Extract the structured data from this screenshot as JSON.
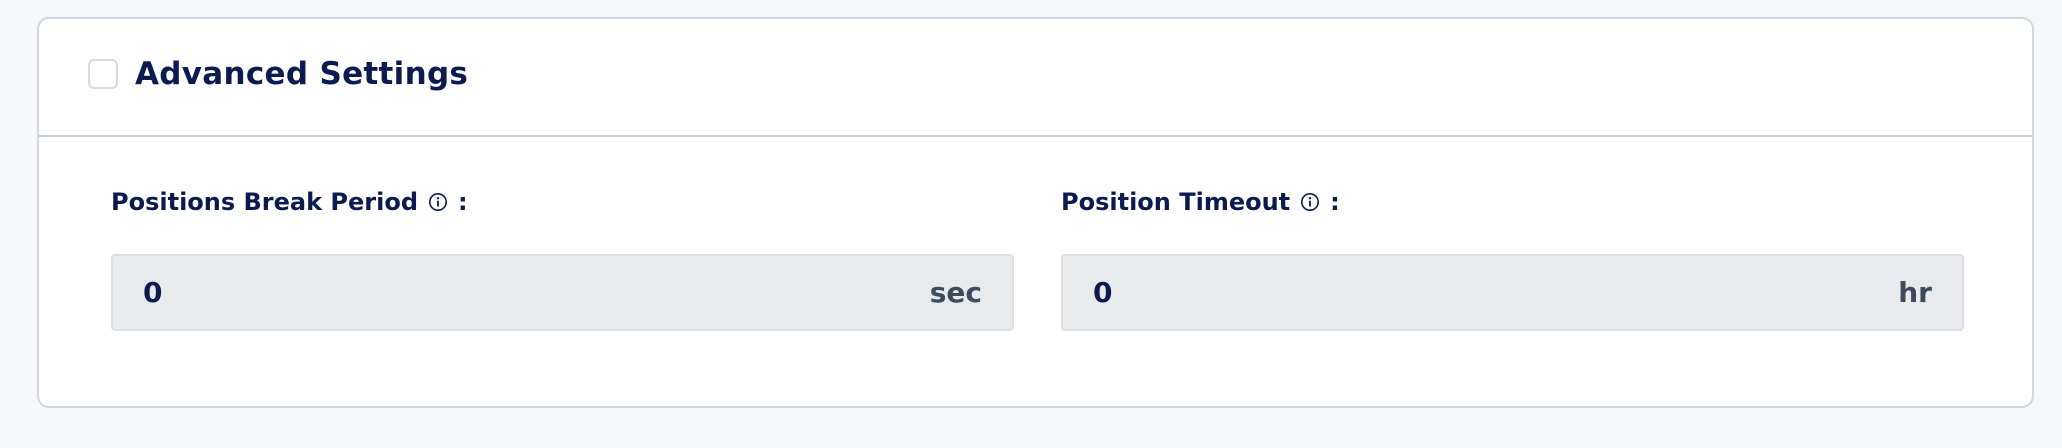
{
  "advanced_settings": {
    "title": "Advanced Settings",
    "checked": false
  },
  "fields": [
    {
      "label": "Positions Break Period",
      "colon": ":",
      "value": "0",
      "unit": "sec",
      "info_icon": "info-circle-icon"
    },
    {
      "label": "Position Timeout",
      "colon": ":",
      "value": "0",
      "unit": "hr",
      "info_icon": "info-circle-icon"
    }
  ],
  "colors": {
    "text_primary": "#0b1b4f",
    "input_bg": "#e8eaec",
    "border": "#cfd6dc",
    "page_bg": "#f7f8fc"
  }
}
